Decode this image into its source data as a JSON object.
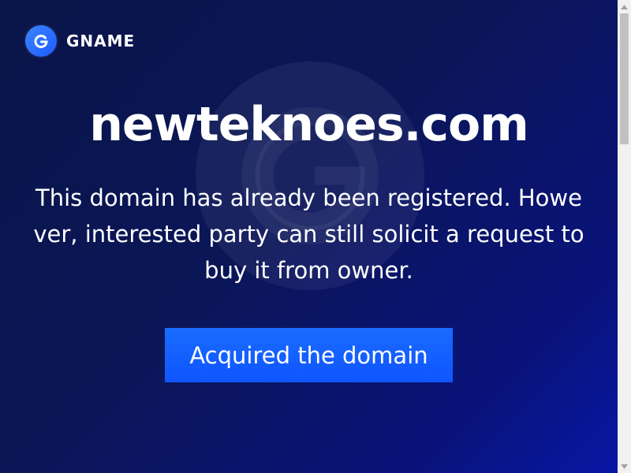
{
  "brand": {
    "name": "GNAME",
    "icon": "gname-logo-icon",
    "accent_color": "#1e5bff"
  },
  "page": {
    "domain": "newteknoes.com",
    "message": "This domain has already been registered. However, interested party can still solicit a request to buy it from owner."
  },
  "actions": {
    "acquire_label": "Acquired the domain"
  },
  "colors": {
    "background_start": "#0a1548",
    "background_end": "#0717a8",
    "button": "#1a6cff",
    "text": "#ffffff"
  }
}
